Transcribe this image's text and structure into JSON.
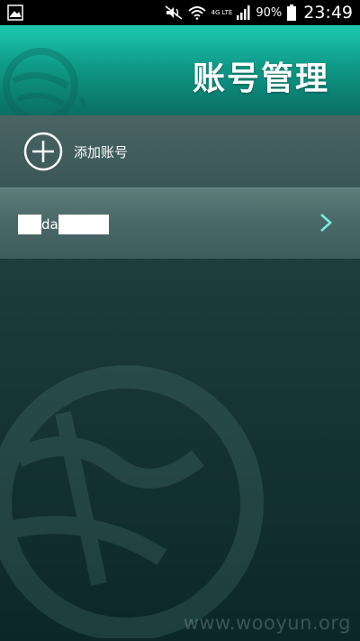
{
  "status_bar": {
    "network": "4G LTE",
    "battery": "90%",
    "time": "23:49"
  },
  "header": {
    "title": "账号管理"
  },
  "add_account": {
    "label": "添加账号"
  },
  "accounts": [
    {
      "name_visible": "da"
    }
  ],
  "watermark": "www.wooyun.org",
  "colors": {
    "header_accent": "#1cc9b0",
    "chevron": "#6ff0de"
  }
}
